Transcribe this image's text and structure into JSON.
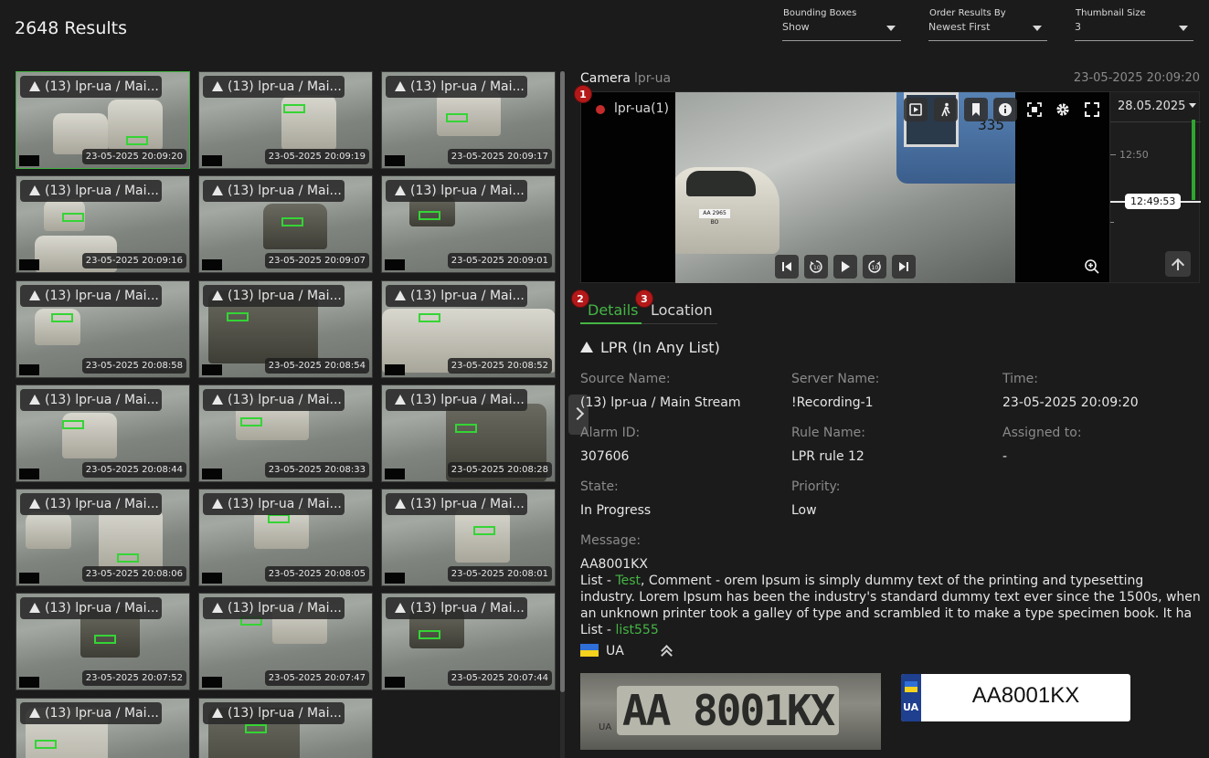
{
  "header": {
    "results_count": "2648 Results",
    "bounding_boxes": {
      "label": "Bounding Boxes",
      "value": "Show"
    },
    "order_results": {
      "label": "Order Results By",
      "value": "Newest First"
    },
    "thumbnail_size": {
      "label": "Thumbnail Size",
      "value": "3"
    }
  },
  "thumbnails": [
    {
      "title": "(13) lpr-ua / Mai...",
      "timestamp": "23-05-2025 20:09:20"
    },
    {
      "title": "(13) lpr-ua / Mai...",
      "timestamp": "23-05-2025 20:09:19"
    },
    {
      "title": "(13) lpr-ua / Mai...",
      "timestamp": "23-05-2025 20:09:17"
    },
    {
      "title": "(13) lpr-ua / Mai...",
      "timestamp": "23-05-2025 20:09:16"
    },
    {
      "title": "(13) lpr-ua / Mai...",
      "timestamp": "23-05-2025 20:09:07"
    },
    {
      "title": "(13) lpr-ua / Mai...",
      "timestamp": "23-05-2025 20:09:01"
    },
    {
      "title": "(13) lpr-ua / Mai...",
      "timestamp": "23-05-2025 20:08:58"
    },
    {
      "title": "(13) lpr-ua / Mai...",
      "timestamp": "23-05-2025 20:08:54"
    },
    {
      "title": "(13) lpr-ua / Mai...",
      "timestamp": "23-05-2025 20:08:52"
    },
    {
      "title": "(13) lpr-ua / Mai...",
      "timestamp": "23-05-2025 20:08:44"
    },
    {
      "title": "(13) lpr-ua / Mai...",
      "timestamp": "23-05-2025 20:08:33"
    },
    {
      "title": "(13) lpr-ua / Mai...",
      "timestamp": "23-05-2025 20:08:28"
    },
    {
      "title": "(13) lpr-ua / Mai...",
      "timestamp": "23-05-2025 20:08:06"
    },
    {
      "title": "(13) lpr-ua / Mai...",
      "timestamp": "23-05-2025 20:08:05"
    },
    {
      "title": "(13) lpr-ua / Mai...",
      "timestamp": "23-05-2025 20:08:01"
    },
    {
      "title": "(13) lpr-ua / Mai...",
      "timestamp": "23-05-2025 20:07:52"
    },
    {
      "title": "(13) lpr-ua / Mai...",
      "timestamp": "23-05-2025 20:07:47"
    },
    {
      "title": "(13) lpr-ua / Mai...",
      "timestamp": "23-05-2025 20:07:44"
    },
    {
      "title": "(13) lpr-ua / Mai...",
      "timestamp": ""
    },
    {
      "title": "(13) lpr-ua / Mai...",
      "timestamp": ""
    }
  ],
  "camera": {
    "label": "Camera",
    "name": "lpr-ua",
    "timestamp": "23-05-2025 20:09:20",
    "stream_label": "lpr-ua(1)",
    "bus_number": "335",
    "car_plate": "AA 2965 BO"
  },
  "timeline": {
    "date": "28.05.2025",
    "tick_label": "12:50",
    "cursor_time": "12:49:53"
  },
  "badges": {
    "b1": "1",
    "b2": "2",
    "b3": "3"
  },
  "tabs": {
    "details": "Details",
    "location": "Location"
  },
  "details": {
    "event_title": "LPR (In Any List)",
    "source_name": {
      "label": "Source Name:",
      "value": "(13) lpr-ua / Main Stream"
    },
    "server_name": {
      "label": "Server Name:",
      "value": "!Recording-1"
    },
    "time": {
      "label": "Time:",
      "value": "23-05-2025 20:09:20"
    },
    "alarm_id": {
      "label": "Alarm ID:",
      "value": "307606"
    },
    "rule_name": {
      "label": "Rule Name:",
      "value": "LPR rule 12"
    },
    "assigned_to": {
      "label": "Assigned to:",
      "value": "-"
    },
    "state": {
      "label": "State:",
      "value": "In Progress"
    },
    "priority": {
      "label": "Priority:",
      "value": "Low"
    },
    "message_label": "Message:",
    "message": {
      "plate": "AA8001KX",
      "list_prefix": "List - ",
      "list_name": "Test",
      "comment": ", Comment - orem Ipsum is simply dummy text of the printing and typesetting industry. Lorem Ipsum has been the industry's standard dummy text ever since the 1500s, when an unknown printer took a galley of type and scrambled it to make a type specimen book. It ha",
      "list_prefix_2": "List - ",
      "list_name_2": "list555"
    },
    "country": "UA",
    "plate_crop_text": "AA 8001KX",
    "plate_crop_country": "UA",
    "plate_card_country": "UA",
    "plate_card_number": "AA8001KX"
  },
  "colors": {
    "accent": "#45b545",
    "badge": "#b41818",
    "background": "#1b1b1b"
  }
}
